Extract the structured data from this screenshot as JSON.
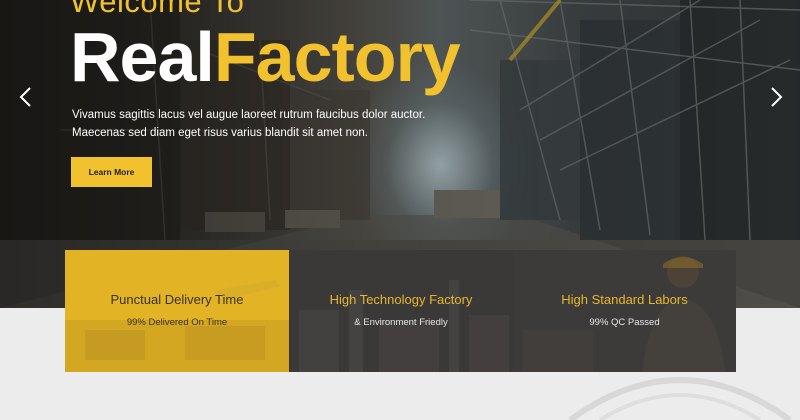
{
  "hero": {
    "welcome": "Welcome To",
    "title_part1": "Real",
    "title_part2": "Factory",
    "description": "Vivamus sagittis lacus vel augue laoreet rutrum faucibus dolor auctor. Maecenas sed diam eget risus varius blandit sit amet non.",
    "button_label": "Learn More",
    "prev_icon": "chevron-left-icon",
    "next_icon": "chevron-right-icon"
  },
  "features": [
    {
      "title": "Punctual Delivery Time",
      "subtitle": "99% Delivered On Time"
    },
    {
      "title": "High Technology Factory",
      "subtitle": "& Environment Friedly"
    },
    {
      "title": "High Standard Labors",
      "subtitle": "99% QC Passed"
    }
  ],
  "colors": {
    "accent": "#f2c12e",
    "dark_panel": "#3a3938",
    "page_background": "#ececec"
  }
}
